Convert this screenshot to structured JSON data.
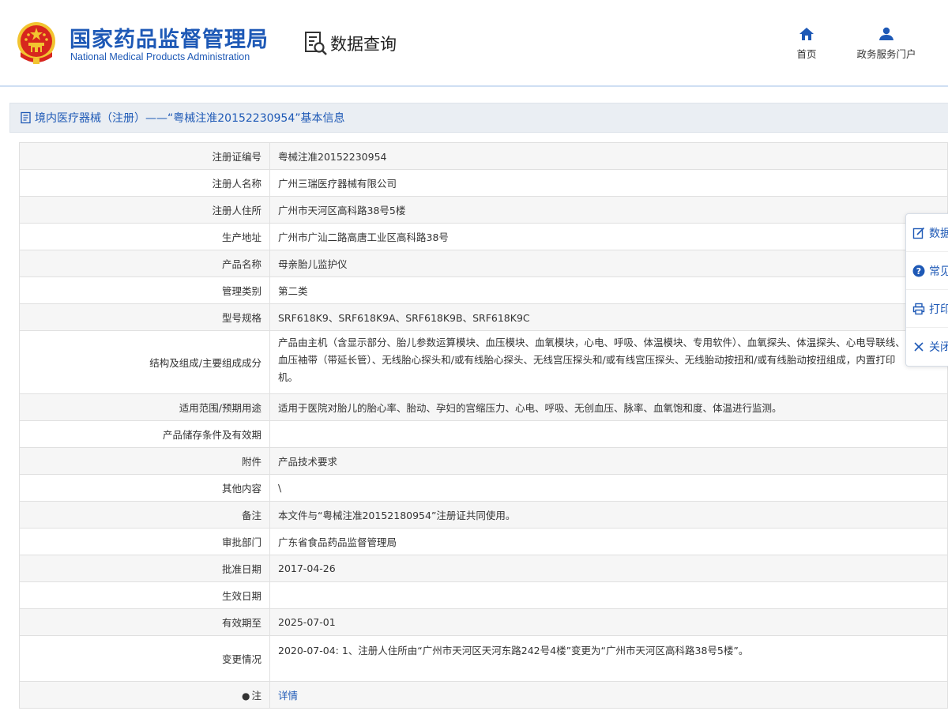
{
  "header": {
    "org_name_cn": "国家药品监督管理局",
    "org_name_en": "National Medical Products Administration",
    "query_label": "数据查询",
    "nav": [
      {
        "label": "首页",
        "icon": "home-icon"
      },
      {
        "label": "政务服务门户",
        "icon": "user-icon"
      }
    ]
  },
  "breadcrumb": {
    "icon": "document-icon",
    "text": "境内医疗器械（注册）——“粤械注准20152230954”基本信息"
  },
  "table": {
    "rows": [
      {
        "label": "注册证编号",
        "value": "粤械注准20152230954"
      },
      {
        "label": "注册人名称",
        "value": "广州三瑞医疗器械有限公司"
      },
      {
        "label": "注册人住所",
        "value": "广州市天河区高科路38号5楼"
      },
      {
        "label": "生产地址",
        "value": "广州市广汕二路高唐工业区高科路38号"
      },
      {
        "label": "产品名称",
        "value": "母亲胎儿监护仪"
      },
      {
        "label": "管理类别",
        "value": "第二类"
      },
      {
        "label": "型号规格",
        "value": "SRF618K9、SRF618K9A、SRF618K9B、SRF618K9C"
      },
      {
        "label": "结构及组成/主要组成成分",
        "value": "产品由主机（含显示部分、胎儿参数运算模块、血压模块、血氧模块，心电、呼吸、体温模块、专用软件）、血氧探头、体温探头、心电导联线、血压袖带（带延长管）、无线胎心探头和/或有线胎心探头、无线宫压探头和/或有线宫压探头、无线胎动按扭和/或有线胎动按扭组成，内置打印机。"
      },
      {
        "label": "适用范围/预期用途",
        "value": "适用于医院对胎儿的胎心率、胎动、孕妇的宫缩压力、心电、呼吸、无创血压、脉率、血氧饱和度、体温进行监测。"
      },
      {
        "label": "产品储存条件及有效期",
        "value": ""
      },
      {
        "label": "附件",
        "value": "产品技术要求"
      },
      {
        "label": "其他内容",
        "value": "\\"
      },
      {
        "label": "备注",
        "value": "本文件与“粤械注准20152180954”注册证共同使用。"
      },
      {
        "label": "审批部门",
        "value": "广东省食品药品监督管理局"
      },
      {
        "label": "批准日期",
        "value": "2017-04-26"
      },
      {
        "label": "生效日期",
        "value": ""
      },
      {
        "label": "有效期至",
        "value": "2025-07-01"
      },
      {
        "label": "变更情况",
        "value": "2020-07-04: 1、注册人住所由“广州市天河区天河东路242号4楼”变更为“广州市天河区高科路38号5楼”。"
      }
    ],
    "note_label": "注",
    "note_link": "详情"
  },
  "float_panel": [
    {
      "label": "数据",
      "icon": "edit-icon"
    },
    {
      "label": "常见",
      "icon": "help-icon"
    },
    {
      "label": "打印",
      "icon": "print-icon"
    },
    {
      "label": "关闭",
      "icon": "close-icon"
    }
  ],
  "colors": {
    "brand_blue": "#1e59b6",
    "emblem_red": "#d7261e",
    "emblem_gold": "#f2c430"
  }
}
